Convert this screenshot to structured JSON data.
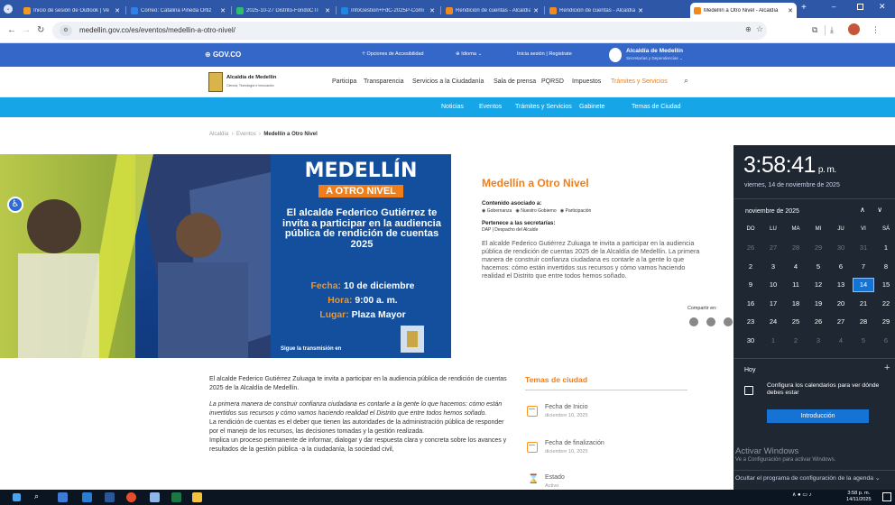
{
  "tabs": [
    {
      "title": "Inicio de sesión de Outlook | Ve",
      "color": "#f39a1e"
    },
    {
      "title": "Correo: Catalina Pineda Ortiz",
      "color": "#2f80e8"
    },
    {
      "title": "2025-10-27 Distrito-FondoCTI",
      "color": "#2dbd6e"
    },
    {
      "title": "InfoGestion+FdC-2025P-Comi",
      "color": "#1e88e5"
    },
    {
      "title": "Rendición de cuentas - Alcaldía",
      "color": "#f08a1c"
    },
    {
      "title": "Rendición de cuentas - Alcaldía",
      "color": "#f08a1c"
    },
    {
      "title": "Medellín a Otro Nivel - Alcaldía",
      "color": "#f08a1c"
    }
  ],
  "url": "medellin.gov.co/es/eventos/medellin-a-otro-nivel/",
  "gov": {
    "logo": "GOV.CO",
    "accesibilidad": "Opciones de Accesibilidad",
    "idioma": "Idioma",
    "login": "Inicia sesión | Registrate",
    "entity": "Alcaldía de Medellín",
    "entity_sub": "Secretarías y Dependencias"
  },
  "mainnav": {
    "brand": "Alcaldía de Medellín",
    "brand_sub": "Ciencia, Tecnología e Innovación",
    "items": [
      "Participa",
      "Transparencia",
      "Servicios a la Ciudadanía",
      "Sala de prensa",
      "PQRSD",
      "Impuestos",
      "Trámites y Servicios"
    ]
  },
  "secnav": [
    "Noticias",
    "Eventos",
    "Trámites y Servicios",
    "Gabinete",
    "Temas de Ciudad"
  ],
  "breadcrumb": [
    "Alcaldía",
    "Eventos",
    "Medellín a Otro Nivel"
  ],
  "banner": {
    "title": "MEDELLÍN",
    "subtitle": "A OTRO NIVEL",
    "body": "El alcalde Federico Gutiérrez te invita a participar en la audiencia pública de rendición de cuentas 2025",
    "fecha_label": "Fecha:",
    "fecha": "10 de diciembre",
    "hora_label": "Hora:",
    "hora": "9:00 a. m.",
    "lugar_label": "Lugar:",
    "lugar": "Plaza Mayor",
    "footer": "Sigue la transmisión en"
  },
  "event": {
    "title": "Medellín a Otro Nivel",
    "contenido_label": "Contenido asociado a:",
    "tags": [
      "Gobernanza",
      "Nuestro Gobierno",
      "Participación"
    ],
    "secretarias_label": "Pertenece a las secretarías:",
    "secretarias": "DAP | Despacho del Alcalde",
    "description": "El alcalde Federico Gutiérrez Zuluaga te invita a participar en la audiencia pública de rendición de cuentas 2025 de la Alcaldía de Medellín. La primera manera de construir confianza ciudadana es contarle a la gente lo que hacemos: cómo están invertidos sus recursos y cómo vamos haciendo realidad el Distrito que entre todos hemos soñado.",
    "share": "Compartir en:"
  },
  "body": {
    "p1": "El alcalde Federico Gutiérrez Zuluaga te invita a participar en la audiencia pública de rendición de cuentas 2025 de la Alcaldía de Medellín.",
    "p2": "La primera manera de construir confianza ciudadana es contarle a la gente lo que hacemos: cómo están invertidos sus recursos y cómo vamos haciendo realidad el Distrito que entre todos hemos soñado.",
    "p3": "La rendición de cuentas es el deber que tienen las autoridades de la administración pública de responder por el manejo de los recursos, las decisiones tomadas y la gestión realizada.",
    "p4": "Implica un proceso permanente de informar, dialogar y dar respuesta clara y concreta sobre los avances y resultados de la gestión pública -a la ciudadanía, la sociedad civil,"
  },
  "temas": {
    "title": "Temas de ciudad",
    "items": [
      {
        "label": "Fecha de Inicio",
        "value": "diciembre 10, 2025"
      },
      {
        "label": "Fecha de finalización",
        "value": "diciembre 10, 2025"
      },
      {
        "label": "Estado",
        "value": "Activo"
      }
    ]
  },
  "flyout": {
    "time": "3:58:41",
    "ampm": "p. m.",
    "date": "viernes, 14 de noviembre de 2025",
    "month": "noviembre de 2025",
    "weekdays": [
      "DO",
      "LU",
      "MA",
      "MI",
      "JU",
      "VI",
      "SÁ"
    ],
    "days": [
      26,
      27,
      28,
      29,
      30,
      31,
      1,
      2,
      3,
      4,
      5,
      6,
      7,
      8,
      9,
      10,
      11,
      12,
      13,
      14,
      15,
      16,
      17,
      18,
      19,
      20,
      21,
      22,
      23,
      24,
      25,
      26,
      27,
      28,
      29,
      30,
      1,
      2,
      3,
      4,
      5,
      6
    ],
    "today_index": 19,
    "first_in_month": 6,
    "last_in_month": 35,
    "hoy": "Hoy",
    "config_text": "Configura los calendarios para ver dónde debes estar",
    "intro_button": "Introducción",
    "activate": "Activar Windows",
    "activate_sub": "Ve a Configuración para activar Windows.",
    "hide": "Ocultar el programa de configuración de la agenda"
  },
  "taskbar": {
    "time": "3:58 p. m.",
    "date": "14/11/2025"
  }
}
